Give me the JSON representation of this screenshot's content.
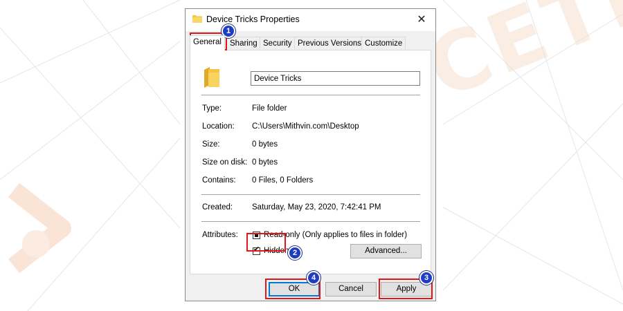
{
  "window": {
    "title": "Device Tricks Properties",
    "close_label": "✕"
  },
  "tabs": [
    {
      "label": "General",
      "active": true
    },
    {
      "label": "Sharing",
      "active": false
    },
    {
      "label": "Security",
      "active": false
    },
    {
      "label": "Previous Versions",
      "active": false
    },
    {
      "label": "Customize",
      "active": false
    }
  ],
  "general": {
    "name_value": "Device Tricks",
    "rows": [
      {
        "label": "Type:",
        "value": "File folder"
      },
      {
        "label": "Location:",
        "value": "C:\\Users\\Mithvin.com\\Desktop"
      },
      {
        "label": "Size:",
        "value": "0 bytes"
      },
      {
        "label": "Size on disk:",
        "value": "0 bytes"
      },
      {
        "label": "Contains:",
        "value": "0 Files, 0 Folders"
      }
    ],
    "created": {
      "label": "Created:",
      "value": "Saturday, May 23, 2020, 7:42:41 PM"
    },
    "attributes": {
      "label": "Attributes:",
      "readonly_label": "Read-only (Only applies to files in folder)",
      "readonly_state": "indeterminate",
      "hidden_label": "Hidden",
      "hidden_checked": true,
      "advanced_label": "Advanced..."
    }
  },
  "buttons": {
    "ok": "OK",
    "cancel": "Cancel",
    "apply": "Apply"
  },
  "annotations": [
    {
      "number": "1",
      "target": "General tab"
    },
    {
      "number": "2",
      "target": "Hidden checkbox"
    },
    {
      "number": "3",
      "target": "Apply button"
    },
    {
      "number": "4",
      "target": "OK button"
    }
  ],
  "colors": {
    "highlight": "#e01717",
    "marker": "#1f3dc2",
    "watermark": "#f6dfcf",
    "folder": "#f5c440"
  }
}
